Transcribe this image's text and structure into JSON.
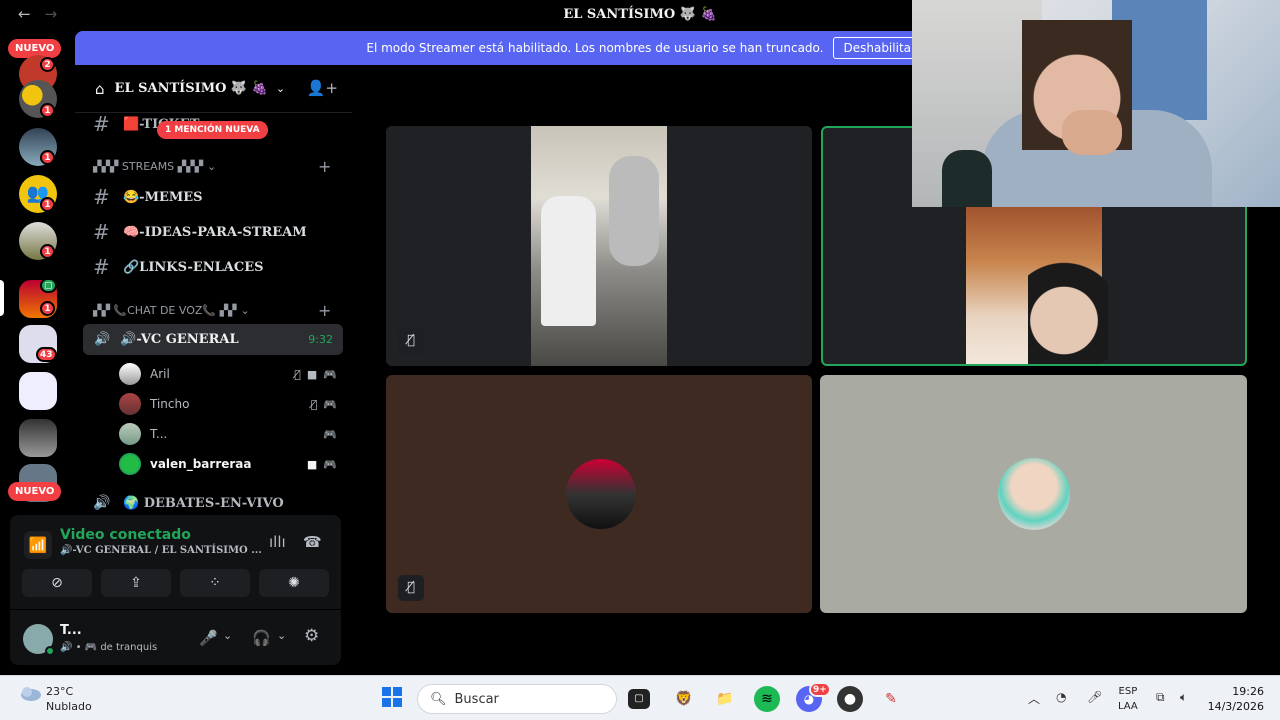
{
  "window": {
    "title": "EL SANTÍSIMO 🐺 🍇",
    "back": "←",
    "forward": "→"
  },
  "banner": {
    "message": "El modo Streamer está habilitado. Los nombres de usuario se han truncado.",
    "button": "Deshabilita"
  },
  "rail": {
    "nuevo_top": "NUEVO",
    "nuevo_bottom": "NUEVO",
    "badges": [
      "2",
      "1",
      "1",
      "1",
      "1",
      "1",
      "43"
    ]
  },
  "server": {
    "name": "EL SANTÍSIMO 🐺 🍇"
  },
  "sidebar": {
    "mention_pill": "1 MENCIÓN NUEVA",
    "ticket_channel": "🟥-TICKET",
    "streams_category": "▞▞▞ STREAMS ▞▞▞",
    "channels": [
      {
        "name": "😂-MEMES"
      },
      {
        "name": "🧠-IDEAS-PARA-STREAM"
      },
      {
        "name": "🔗LINKS-ENLACES"
      }
    ],
    "voice_category": "▞▞ 📞CHAT DE VOZ📞 ▞▞",
    "active_voice": {
      "name": "🔊-VC GENERAL",
      "time": "9:32"
    },
    "members": [
      {
        "name": "Aril"
      },
      {
        "name": "Tincho"
      },
      {
        "name": "T..."
      },
      {
        "name": "valen_barreraa"
      }
    ],
    "next_voice": "🌍 DEBATES-EN-VIVO"
  },
  "voice_panel": {
    "state": "Video conectado",
    "location": "🔊-VC GENERAL / EL SANTÍSIMO ..."
  },
  "user_panel": {
    "name": "T...",
    "status": "🔊 • 🎮 de tranquis"
  },
  "taskbar": {
    "weather_temp": "23°C",
    "weather_desc": "Nublado",
    "search_placeholder": "Buscar",
    "lang_top": "ESP",
    "lang_bottom": "LAA",
    "time": "19:26",
    "date": "14/3/2026",
    "discord_badge": "9+"
  },
  "colors": {
    "accent": "#5865f2",
    "online": "#23a55a",
    "badge": "#f23f43"
  }
}
